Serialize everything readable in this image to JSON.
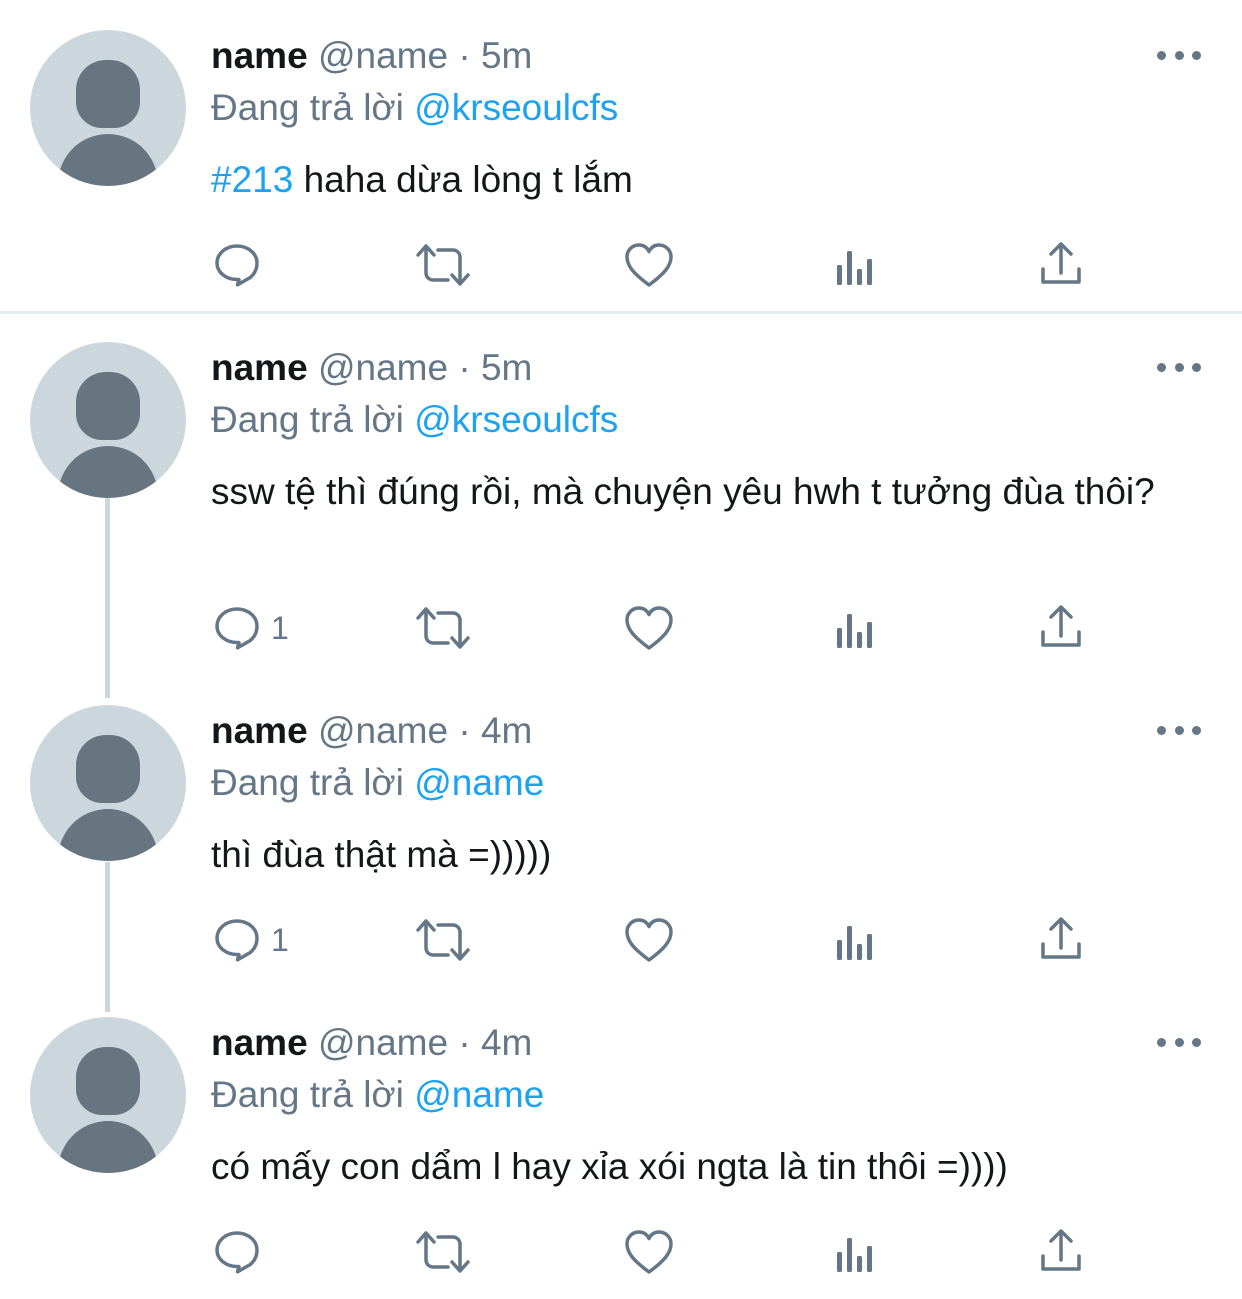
{
  "theme": {
    "text_color": "#14171a",
    "muted_color": "#657786",
    "link_color": "#1da1f2",
    "avatar_bg": "#ccd6dd",
    "avatar_fg": "#66757f"
  },
  "icons": {
    "reply": "reply-icon",
    "retweet": "retweet-icon",
    "like": "heart-icon",
    "views": "analytics-icon",
    "share": "share-icon",
    "more": "more-options-icon"
  },
  "tweets": [
    {
      "display_name": "name",
      "handle": "@name",
      "time": "· 5m",
      "reply_prefix": "Đang trả lời",
      "reply_to": "@krseoulcfs",
      "hashtag": "#213",
      "text": " haha dừa lòng t lắm",
      "reply_count": ""
    },
    {
      "display_name": "name",
      "handle": "@name",
      "time": "· 5m",
      "reply_prefix": "Đang trả lời",
      "reply_to": "@krseoulcfs",
      "hashtag": "",
      "text": "ssw tệ thì đúng rồi, mà chuyện yêu hwh t tưởng đùa thôi?",
      "reply_count": "1"
    },
    {
      "display_name": "name",
      "handle": "@name",
      "time": "· 4m",
      "reply_prefix": "Đang trả lời",
      "reply_to": "@name",
      "hashtag": "",
      "text": "thì đùa thật mà =)))))",
      "reply_count": "1"
    },
    {
      "display_name": "name",
      "handle": "@name",
      "time": "· 4m",
      "reply_prefix": "Đang trả lời",
      "reply_to": "@name",
      "hashtag": "",
      "text": "có mấy con dẩm l hay xỉa xói ngta là tin thôi =))))",
      "reply_count": ""
    }
  ]
}
